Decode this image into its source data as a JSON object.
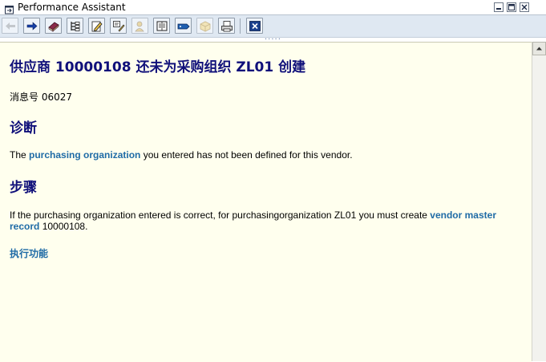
{
  "window": {
    "title": "Performance Assistant",
    "controls": [
      "minimize",
      "maximize",
      "close"
    ]
  },
  "toolbar": {
    "buttons": [
      {
        "name": "back",
        "icon": "arrow-left-icon",
        "enabled": false
      },
      {
        "name": "forward",
        "icon": "arrow-right-icon",
        "enabled": true
      },
      {
        "name": "book",
        "icon": "book-icon",
        "enabled": true
      },
      {
        "name": "structure",
        "icon": "hierarchy-icon",
        "enabled": true
      },
      {
        "name": "edit",
        "icon": "pencil-icon",
        "enabled": true
      },
      {
        "name": "technical-info",
        "icon": "tech-info-icon",
        "enabled": true
      },
      {
        "name": "user",
        "icon": "person-icon",
        "enabled": false
      },
      {
        "name": "document",
        "icon": "document-icon",
        "enabled": true
      },
      {
        "name": "tag",
        "icon": "tag-icon",
        "enabled": true
      },
      {
        "name": "transport",
        "icon": "package-icon",
        "enabled": false
      },
      {
        "name": "print",
        "icon": "printer-icon",
        "enabled": true
      },
      {
        "name": "close",
        "icon": "close-icon",
        "enabled": true
      }
    ],
    "grip": "....."
  },
  "content": {
    "heading": "供应商  10000108 还未为采购组织  ZL01 创建",
    "message_number": "消息号  06027",
    "diagnosis": {
      "heading": "诊断",
      "text_before": "The ",
      "link": "purchasing organization",
      "text_after": " you entered has not been defined for this vendor."
    },
    "procedure": {
      "heading": "步骤",
      "text_before": "If the purchasing organization entered is correct, for purchasingorganization ZL01 you must create ",
      "link": "vendor master record",
      "text_after": " 10000108."
    },
    "execute_link": "执行功能"
  },
  "colors": {
    "content_background": "#ffffee",
    "heading": "#10107a",
    "link": "#1f6ba6",
    "toolbar": "#dfe8f2"
  }
}
